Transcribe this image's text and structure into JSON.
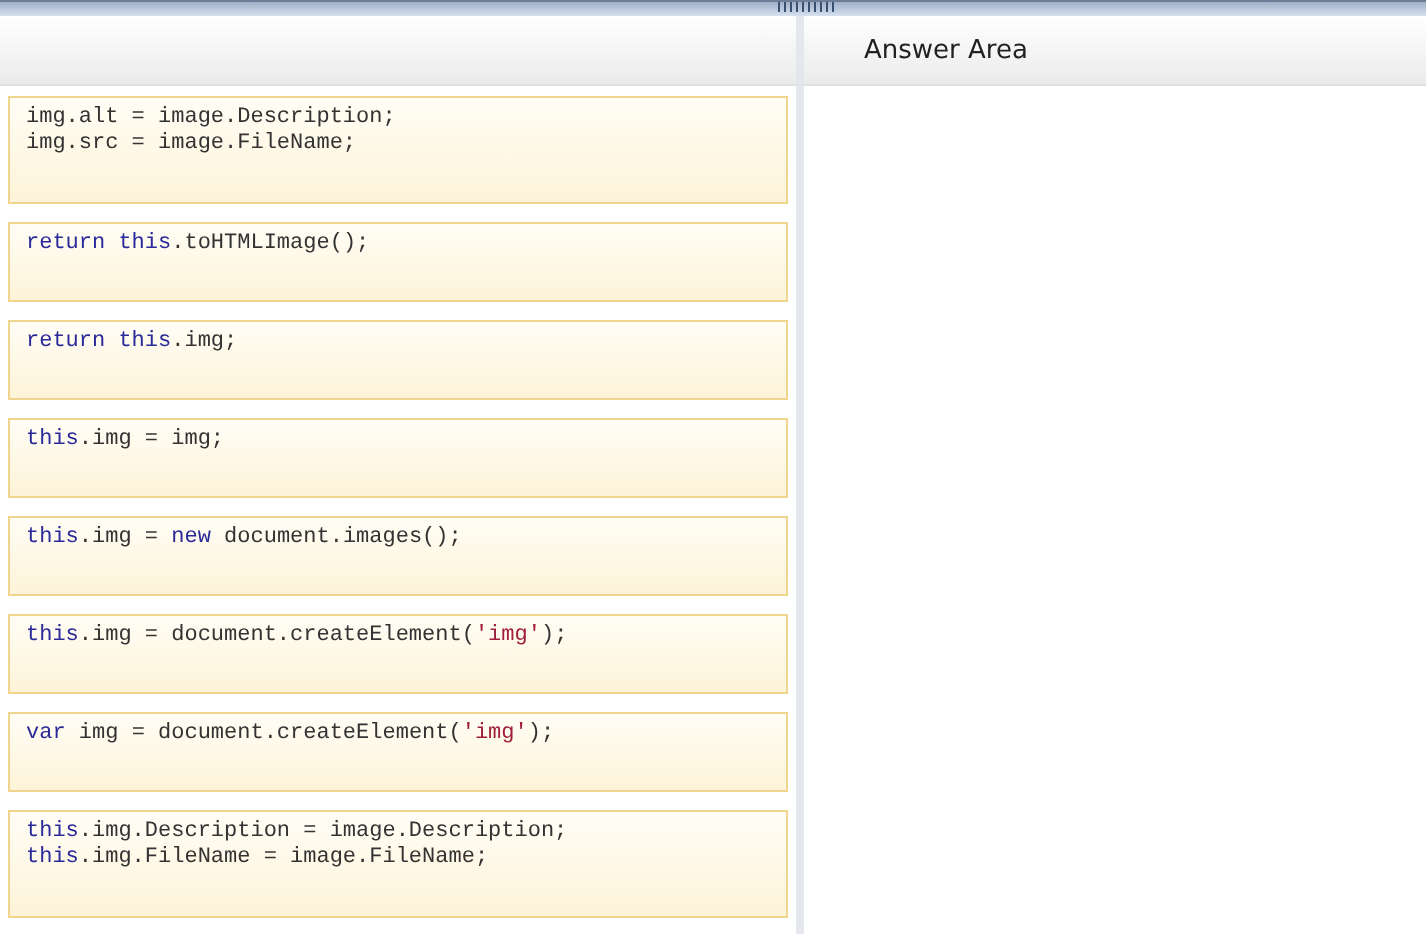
{
  "answer_area": {
    "title": "Answer Area"
  },
  "tiles": [
    {
      "lines": [
        [
          {
            "kind": "plain",
            "text": "img.alt = image.Description;"
          }
        ],
        [
          {
            "kind": "plain",
            "text": "img.src = image.FileName;"
          }
        ]
      ]
    },
    {
      "lines": [
        [
          {
            "kind": "keyword",
            "text": "return this"
          },
          {
            "kind": "plain",
            "text": ".toHTMLImage();"
          }
        ]
      ]
    },
    {
      "lines": [
        [
          {
            "kind": "keyword",
            "text": "return this"
          },
          {
            "kind": "plain",
            "text": ".img;"
          }
        ]
      ]
    },
    {
      "lines": [
        [
          {
            "kind": "keyword",
            "text": "this"
          },
          {
            "kind": "plain",
            "text": ".img = img;"
          }
        ]
      ]
    },
    {
      "lines": [
        [
          {
            "kind": "keyword",
            "text": "this"
          },
          {
            "kind": "plain",
            "text": ".img = "
          },
          {
            "kind": "keyword",
            "text": "new"
          },
          {
            "kind": "plain",
            "text": " document.images();"
          }
        ]
      ]
    },
    {
      "lines": [
        [
          {
            "kind": "keyword",
            "text": "this"
          },
          {
            "kind": "plain",
            "text": ".img = document.createElement("
          },
          {
            "kind": "string",
            "text": "'img'"
          },
          {
            "kind": "plain",
            "text": ");"
          }
        ]
      ]
    },
    {
      "lines": [
        [
          {
            "kind": "keyword",
            "text": "var"
          },
          {
            "kind": "plain",
            "text": " img = document.createElement("
          },
          {
            "kind": "string",
            "text": "'img'"
          },
          {
            "kind": "plain",
            "text": ");"
          }
        ]
      ]
    },
    {
      "lines": [
        [
          {
            "kind": "keyword",
            "text": "this"
          },
          {
            "kind": "plain",
            "text": ".img.Description = image.Description;"
          }
        ],
        [
          {
            "kind": "keyword",
            "text": "this"
          },
          {
            "kind": "plain",
            "text": ".img.FileName = image.FileName;"
          }
        ]
      ]
    }
  ]
}
